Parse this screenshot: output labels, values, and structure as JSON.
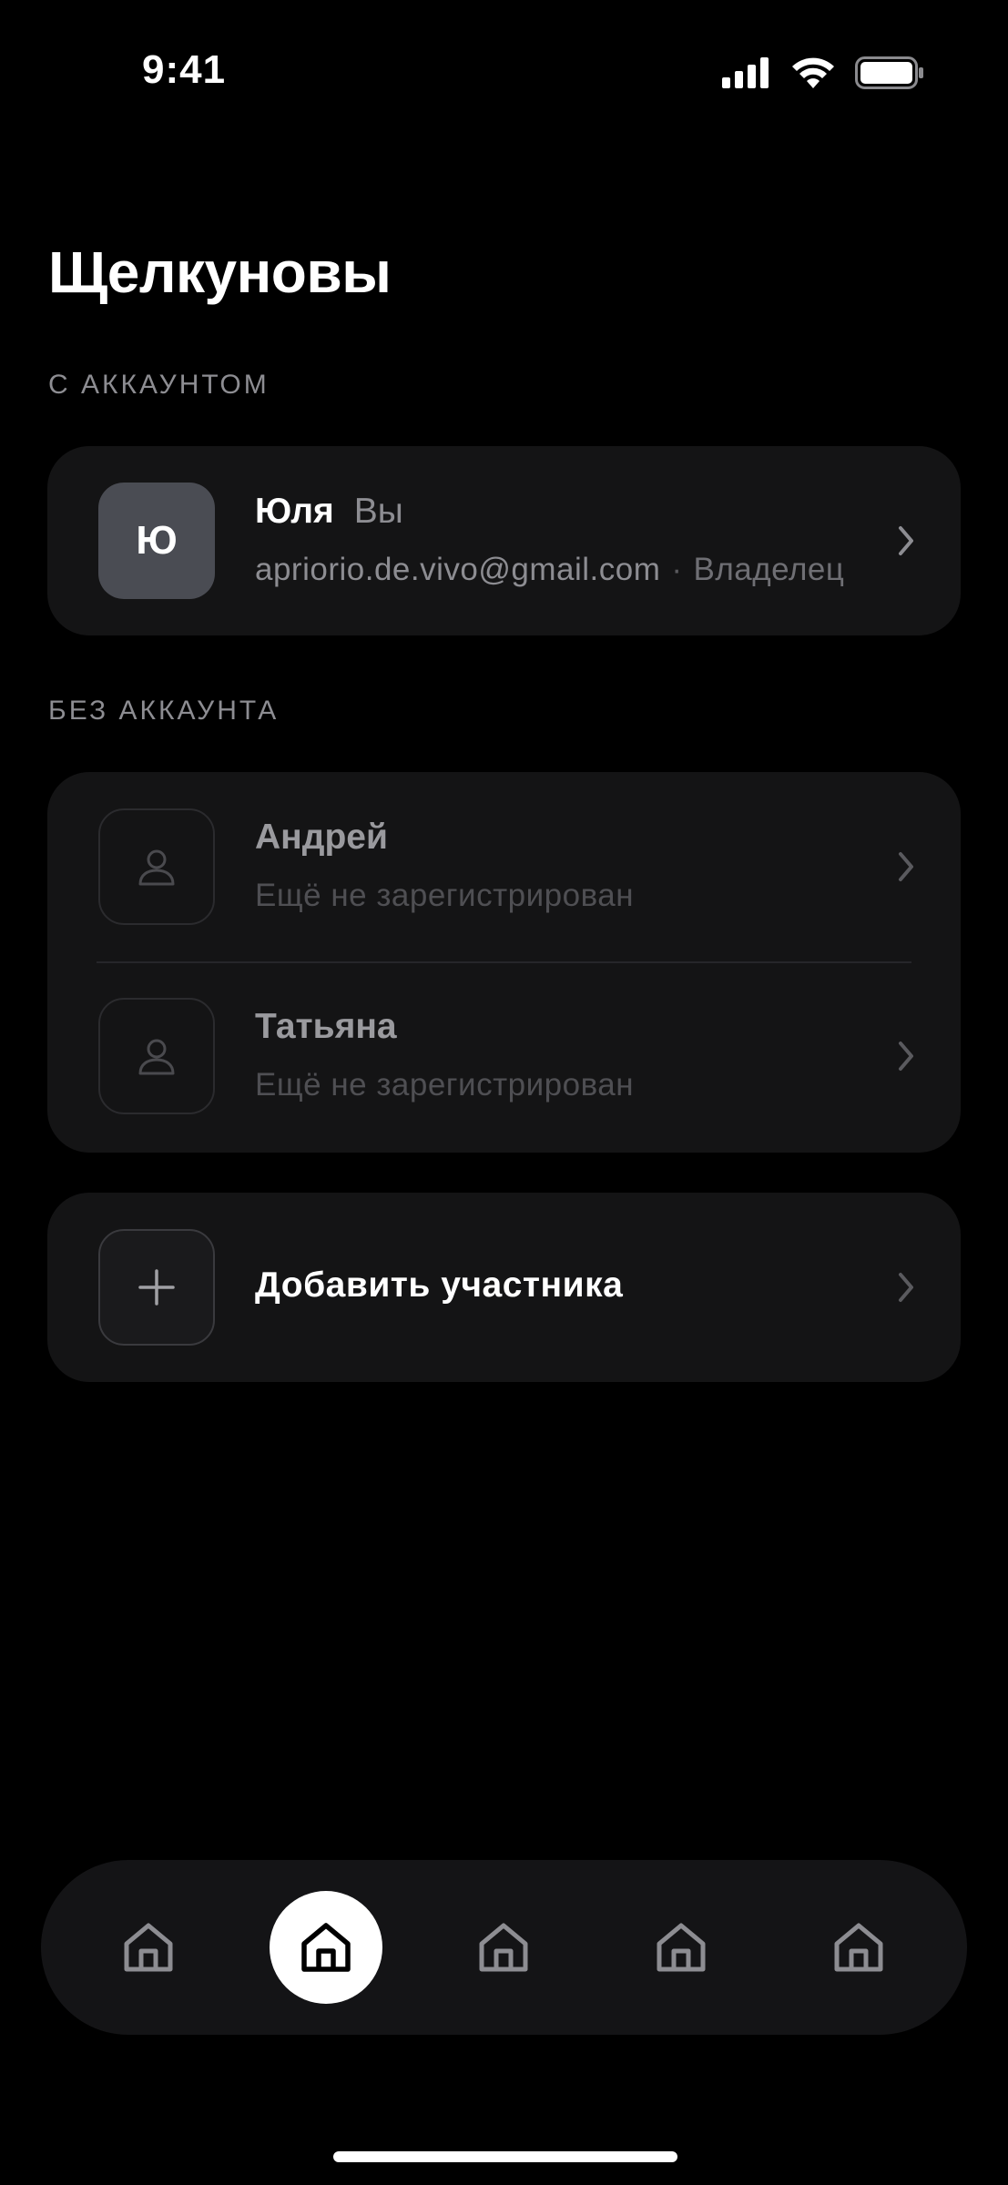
{
  "status_bar": {
    "time": "9:41"
  },
  "page": {
    "title": "Щелкуновы"
  },
  "sections": {
    "with_account": "С АККАУНТОМ",
    "without_account": "БЕЗ АККАУНТА"
  },
  "members_with_account": [
    {
      "initial": "Ю",
      "name": "Юля",
      "you_label": "Вы",
      "email": "apriorio.de.vivo@gmail.com",
      "separator": "·",
      "role": "Владелец"
    }
  ],
  "members_without_account": [
    {
      "name": "Андрей",
      "status": "Ещё не зарегистрирован"
    },
    {
      "name": "Татьяна",
      "status": "Ещё не зарегистрирован"
    }
  ],
  "add_member": {
    "label": "Добавить участника"
  },
  "tab_bar": {
    "tabs": [
      {
        "icon": "home-icon",
        "active": false
      },
      {
        "icon": "home-icon",
        "active": true
      },
      {
        "icon": "home-icon",
        "active": false
      },
      {
        "icon": "home-icon",
        "active": false
      },
      {
        "icon": "home-icon",
        "active": false
      }
    ]
  },
  "colors": {
    "background": "#000000",
    "card": "#141415",
    "muted_text": "#8d8d92",
    "active_tab": "#ffffff"
  }
}
